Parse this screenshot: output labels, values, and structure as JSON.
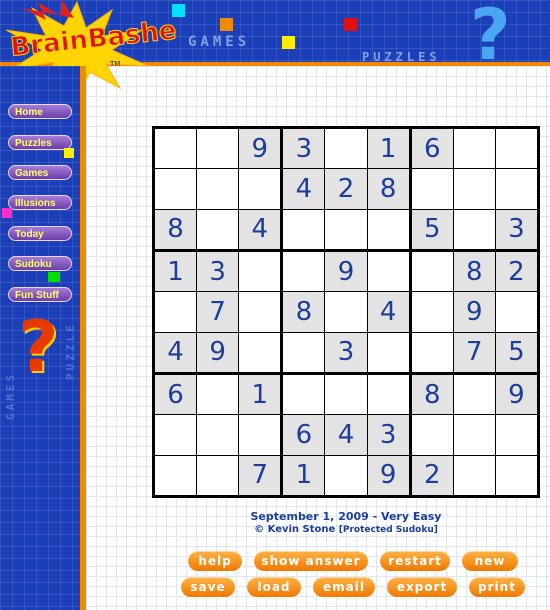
{
  "header": {
    "logo": "BrainBashers",
    "trademark": "TM",
    "word_games": "GAMES",
    "word_puzzles": "PUZZLES",
    "question_mark": "?"
  },
  "sidebar": {
    "items": [
      {
        "label": "Home"
      },
      {
        "label": "Puzzles"
      },
      {
        "label": "Games"
      },
      {
        "label": "Illusions"
      },
      {
        "label": "Today"
      },
      {
        "label": "Sudoku"
      },
      {
        "label": "Fun Stuff"
      }
    ],
    "question_mark": "?",
    "word_games": "GAMES",
    "word_puzzles": "PUZZLE"
  },
  "sudoku": {
    "grid": [
      [
        0,
        0,
        9,
        3,
        0,
        1,
        6,
        0,
        0
      ],
      [
        0,
        0,
        0,
        4,
        2,
        8,
        0,
        0,
        0
      ],
      [
        8,
        0,
        4,
        0,
        0,
        0,
        5,
        0,
        3
      ],
      [
        1,
        3,
        0,
        0,
        9,
        0,
        0,
        8,
        2
      ],
      [
        0,
        7,
        0,
        8,
        0,
        4,
        0,
        9,
        0
      ],
      [
        4,
        9,
        0,
        0,
        3,
        0,
        0,
        7,
        5
      ],
      [
        6,
        0,
        1,
        0,
        0,
        0,
        8,
        0,
        9
      ],
      [
        0,
        0,
        0,
        6,
        4,
        3,
        0,
        0,
        0
      ],
      [
        0,
        0,
        7,
        1,
        0,
        9,
        2,
        0,
        0
      ]
    ],
    "date_line": "September 1, 2009 - Very Easy",
    "credit": "© Kevin Stone",
    "credit_note": "[Protected Sudoku]"
  },
  "actions": {
    "help": "help",
    "show_answer": "show answer",
    "restart": "restart",
    "new": "new",
    "save": "save",
    "load": "load",
    "email": "email",
    "export": "export",
    "print": "print"
  },
  "colors": {
    "brand_blue": "#1a3fb8",
    "accent_orange": "#f08a00",
    "digit_blue": "#1c3e9a",
    "given_cell": "#e3e3e3"
  }
}
